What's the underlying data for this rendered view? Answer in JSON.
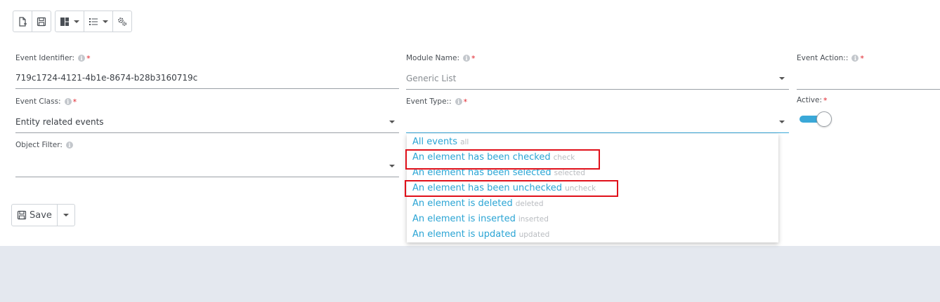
{
  "form": {
    "event_identifier": {
      "label": "Event Identifier:",
      "value": "719c1724-4121-4b1e-8674-b28b3160719c"
    },
    "module_name": {
      "label": "Module Name:",
      "placeholder": "Generic List"
    },
    "event_action": {
      "label": "Event Action::"
    },
    "event_class": {
      "label": "Event Class:",
      "value": "Entity related events"
    },
    "event_type": {
      "label": "Event Type::"
    },
    "active": {
      "label": "Active:",
      "state": true
    },
    "object_filter": {
      "label": "Object Filter:"
    },
    "required_mark": "*",
    "info_glyph": "i"
  },
  "toolbar": {
    "icons": [
      "new-document-icon",
      "save-icon",
      "layout-icon",
      "list-icon",
      "settings-gears-icon"
    ]
  },
  "save_button": {
    "label": "Save"
  },
  "dropdown": {
    "options": [
      {
        "label": "All events",
        "code": "all"
      },
      {
        "label": "An element has been checked",
        "code": "check"
      },
      {
        "label": "An element has been selected",
        "code": "selected"
      },
      {
        "label": "An element has been unchecked",
        "code": "uncheck"
      },
      {
        "label": "An element is deleted",
        "code": "deleted"
      },
      {
        "label": "An element is inserted",
        "code": "inserted"
      },
      {
        "label": "An element is updated",
        "code": "updated"
      }
    ]
  },
  "colors": {
    "accent": "#2aa4d4",
    "required": "#e0212a",
    "highlight": "#e0101a",
    "background": "#e4e8ef"
  }
}
